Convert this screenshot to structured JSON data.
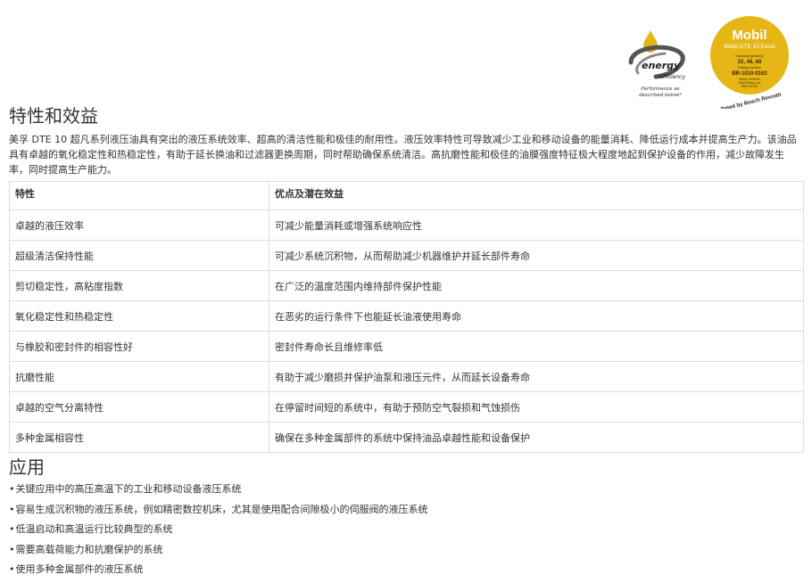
{
  "logos": {
    "energy_word": "energy",
    "efficiency_word": "efficiency",
    "energy_caption_1": "Performance as",
    "energy_caption_2": "described below*",
    "mobil_brand": "Mobil",
    "mobil_product": "Mobil DTE 10 Excel",
    "mobil_viscosity_label": "Viscosity grade(s)",
    "mobil_viscosity_values": "32, 46, 68",
    "mobil_rating_label": "Rating number",
    "mobil_rating_number": "BR-1010-0163",
    "mobil_small_1": "Bosch Rexroth",
    "mobil_small_2": "Fluid Rating List",
    "mobil_small_3": "RDE 90245",
    "mobil_rated_by": "Rated by Bosch Rexroth",
    "colors": {
      "gold": "#e6b617",
      "badge_text": "#3a2a00",
      "mobil_red": "#c8102e"
    }
  },
  "features_section": {
    "title": "特性和效益",
    "intro": "美孚 DTE 10 超凡系列液压油具有突出的液压系统效率、超高的清洁性能和极佳的耐用性。液压效率特性可导致减少工业和移动设备的能量消耗、降低运行成本并提高生产力。该油品具有卓越的氧化稳定性和热稳定性，有助于延长换油和过滤器更换周期，同时帮助确保系统清洁。高抗磨性能和极佳的油膜强度特征极大程度地起到保护设备的作用，减少故障发生率，同时提高生产能力。"
  },
  "table": {
    "headers": [
      "特性",
      "优点及潜在效益"
    ],
    "rows": [
      [
        "卓越的液压效率",
        "可减少能量消耗或增强系统响应性"
      ],
      [
        "超级清洁保持性能",
        "可减少系统沉积物，从而帮助减少机器维护并延长部件寿命"
      ],
      [
        "剪切稳定性，高粘度指数",
        "在广泛的温度范围内维持部件保护性能"
      ],
      [
        "氧化稳定性和热稳定性",
        "在恶劣的运行条件下也能延长油液使用寿命"
      ],
      [
        "与橡胶和密封件的相容性好",
        "密封件寿命长且维修率低"
      ],
      [
        "抗磨性能",
        "有助于减少磨损并保护油泵和液压元件，从而延长设备寿命"
      ],
      [
        "卓越的空气分离特性",
        "在停留时间短的系统中，有助于预防空气裂损和气蚀损伤"
      ],
      [
        "多种金属相容性",
        "确保在多种金属部件的系统中保持油品卓越性能和设备保护"
      ]
    ]
  },
  "applications_section": {
    "title": "应用",
    "items": [
      "关键应用中的高压高温下的工业和移动设备液压系统",
      "容易生成沉积物的液压系统，例如精密数控机床，尤其是使用配合间隙极小的伺服阀的液压系统",
      "低温启动和高温运行比较典型的系统",
      "需要高载荷能力和抗磨保护的系统",
      "使用多种金属部件的液压系统"
    ]
  }
}
